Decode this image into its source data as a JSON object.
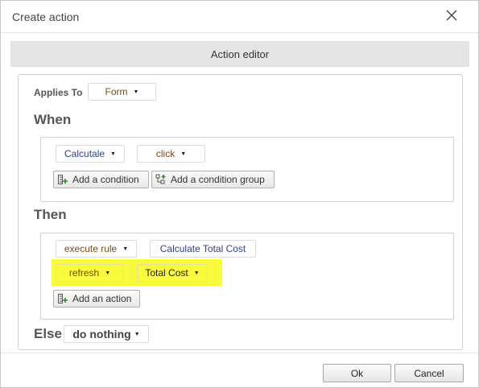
{
  "dialog": {
    "title": "Create action",
    "header": "Action editor"
  },
  "applies_to": {
    "label": "Applies To",
    "value": "Form"
  },
  "when": {
    "title": "When",
    "object": "Calcutale",
    "event": "click",
    "add_condition": "Add a condition",
    "add_condition_group": "Add a condition group"
  },
  "then": {
    "title": "Then",
    "action": "execute rule",
    "rule": "Calculate Total Cost",
    "sub_action": "refresh",
    "target": "Total Cost",
    "add_action": "Add an action"
  },
  "else": {
    "title": "Else",
    "value": "do nothing"
  },
  "footer": {
    "ok": "Ok",
    "cancel": "Cancel"
  },
  "colors": {
    "highlight": "#fafa3c",
    "header_bg": "#e5e5e5"
  },
  "icons": {
    "close": "close-icon",
    "add_condition": "add-condition-icon",
    "add_condition_group": "add-condition-group-icon",
    "add_action": "add-action-icon",
    "caret": "caret-down-icon"
  }
}
